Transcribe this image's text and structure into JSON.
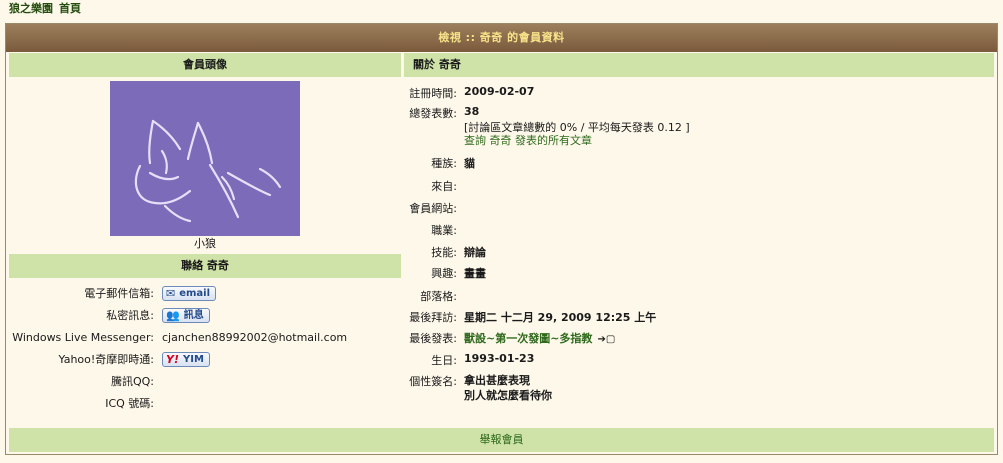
{
  "breadcrumb": {
    "forum": "狼之樂園",
    "home": "首頁"
  },
  "title": "檢視 :: 奇奇 的會員資料",
  "avatar_panel": {
    "heading": "會員頭像",
    "caption": "小狼"
  },
  "contact": {
    "heading": "聯絡 奇奇",
    "rows": [
      {
        "label": "電子郵件信箱:",
        "button": "email",
        "icon": "envelope-icon"
      },
      {
        "label": "私密訊息:",
        "button": "訊息",
        "icon": "users-icon"
      },
      {
        "label": "Windows Live Messenger:",
        "text": "cjanchen88992002@hotmail.com"
      },
      {
        "label": "Yahoo!奇摩即時通:",
        "button": "YIM",
        "icon": "yahoo-icon",
        "icon_text": "Y!"
      },
      {
        "label": "騰訊QQ:"
      },
      {
        "label": "ICQ 號碼:"
      }
    ]
  },
  "about": {
    "heading": "關於 奇奇",
    "joined_label": "註冊時間:",
    "joined": "2009-02-07",
    "posts_label": "總發表數:",
    "posts": "38",
    "posts_stats": "[討論區文章總數的 0% / 平均每天發表 0.12 ]",
    "posts_link": "查詢 奇奇 發表的所有文章",
    "race_label": "種族:",
    "race": "貓",
    "location_label": "來自:",
    "location": "",
    "website_label": "會員網站:",
    "website": "",
    "occupation_label": "職業:",
    "occupation": "",
    "skill_label": "技能:",
    "skill": "辯論",
    "interest_label": "興趣:",
    "interest": "畫畫",
    "blog_label": "部落格:",
    "blog": "",
    "last_visit_label": "最後拜訪:",
    "last_visit": "星期二 十二月 29, 2009 12:25 上午",
    "last_post_label": "最後發表:",
    "last_post": "獸設~第一次發圖~多指教",
    "last_post_icon": "goto-post-icon",
    "birthday_label": "生日:",
    "birthday": "1993-01-23",
    "signature_label": "個性簽名:",
    "signature_line1": "拿出甚麼表現",
    "signature_line2": "別人就怎麼看待你"
  },
  "footer": {
    "report": "舉報會員"
  },
  "colors": {
    "page_bg": "#fdf8ea",
    "titlebar": "#8b6b4a",
    "title_text": "#f7e389",
    "header_green": "#cfe3a8",
    "link_green": "#2f6a1c",
    "avatar_bg": "#7c6bb8"
  }
}
